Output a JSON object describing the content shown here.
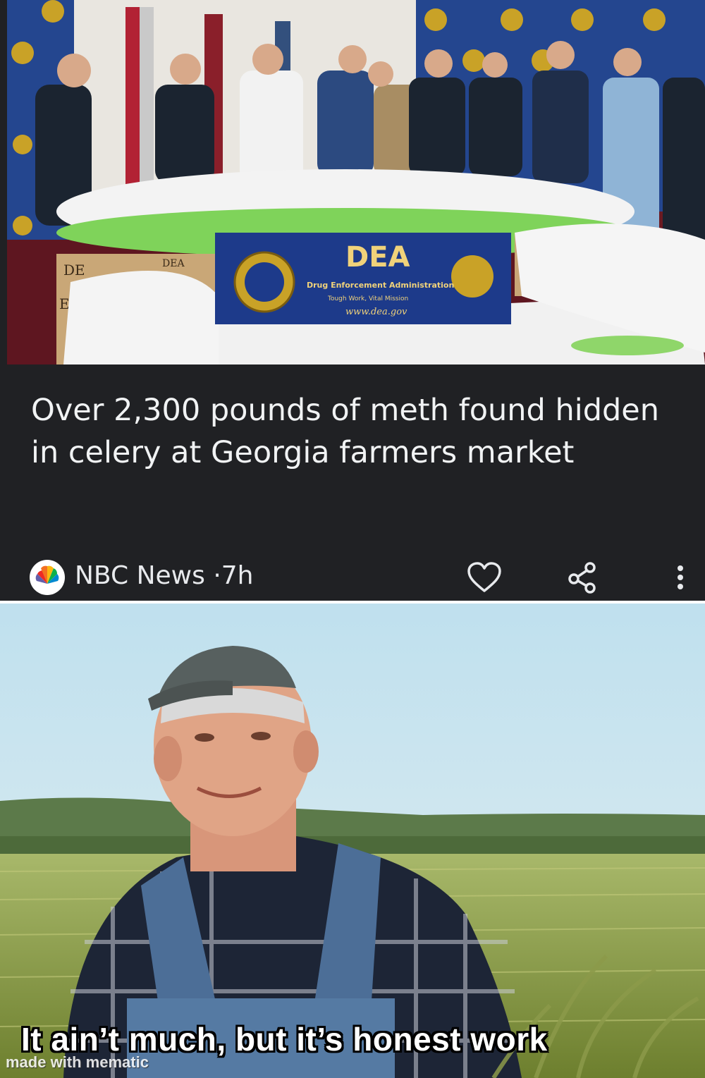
{
  "article": {
    "headline": "Over 2,300 pounds of meth found hidden in celery at Georgia farmers market",
    "source": "NBC News",
    "separator": "·",
    "age": "7h",
    "photo_banner": {
      "title": "DEA",
      "subtitle": "Drug Enforcement Administration",
      "tagline": "Tough Work, Vital Mission",
      "url": "www.dea.gov",
      "box_left_text_1": "DE",
      "box_left_text_2": "EVI",
      "box_top_text": "DEA"
    }
  },
  "meme": {
    "caption": "It ain’t much, but it’s honest work",
    "watermark": "made with mematic"
  },
  "icons": {
    "source_logo": "nbc-peacock-icon",
    "like": "heart-icon",
    "share": "share-icon",
    "more": "more-vert-icon"
  },
  "colors": {
    "card_background": "#202124",
    "headline_text": "#f1f3f4",
    "dea_banner": "#1d3a8a"
  }
}
